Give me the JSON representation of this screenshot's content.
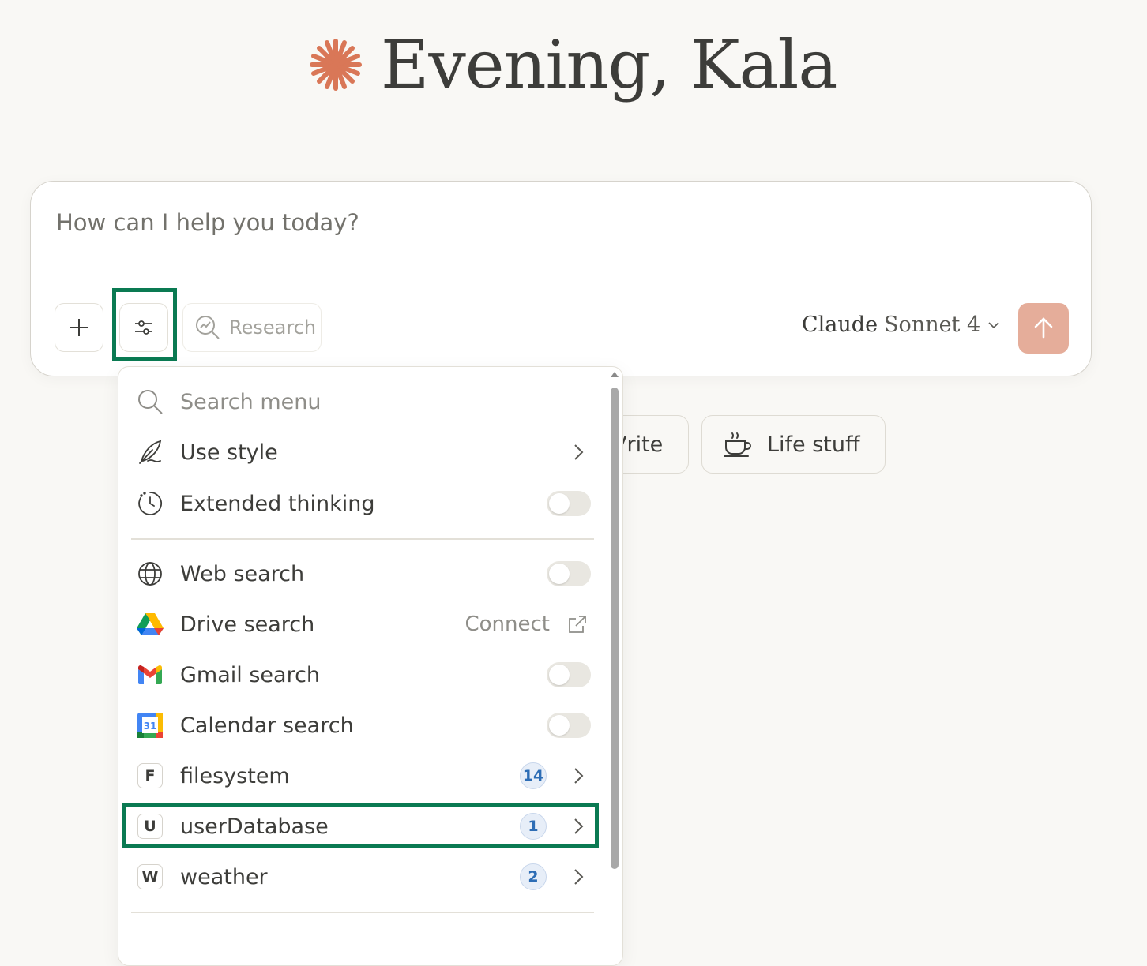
{
  "greeting": {
    "text": "Evening, Kala",
    "accent_color": "#d97757"
  },
  "composer": {
    "placeholder": "How can I help you today?",
    "research_label": "Research",
    "model_name": "Claude",
    "model_variant": "Sonnet 4",
    "send_color": "#e5ad9a"
  },
  "chips": [
    {
      "label": "Write",
      "visible_label": "Vrite",
      "icon": "pencil-icon"
    },
    {
      "label": "Life stuff",
      "icon": "coffee-cup-icon"
    }
  ],
  "menu": {
    "search_placeholder": "Search menu",
    "items": [
      {
        "label": "Use style",
        "icon": "feather-icon",
        "control": "chevron"
      },
      {
        "label": "Extended thinking",
        "icon": "clock-icon",
        "control": "toggle",
        "enabled": false
      },
      {
        "label": "Web search",
        "icon": "globe-icon",
        "control": "toggle",
        "enabled": false
      },
      {
        "label": "Drive search",
        "icon": "google-drive-icon",
        "control": "connect",
        "action_label": "Connect"
      },
      {
        "label": "Gmail search",
        "icon": "gmail-icon",
        "control": "toggle",
        "enabled": false
      },
      {
        "label": "Calendar search",
        "icon": "google-calendar-icon",
        "control": "toggle",
        "enabled": false,
        "icon_text": "31"
      },
      {
        "label": "filesystem",
        "letter": "F",
        "control": "chevron",
        "count": "14"
      },
      {
        "label": "userDatabase",
        "letter": "U",
        "control": "chevron",
        "count": "1",
        "highlighted": true
      },
      {
        "label": "weather",
        "letter": "W",
        "control": "chevron",
        "count": "2"
      }
    ]
  },
  "annotation_color": "#0a7a52"
}
